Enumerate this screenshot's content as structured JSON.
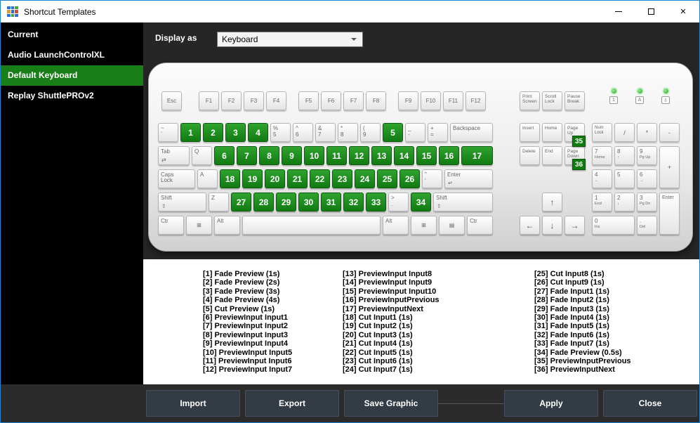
{
  "window": {
    "title": "Shortcut Templates",
    "close_glyph": "×"
  },
  "app_icon_cells": [
    "#2f6fd0",
    "#2f6fd0",
    "#44a544",
    "#e09a3c",
    "#2f6fd0",
    "#cc4b4b",
    "#2f6fd0",
    "#44a544",
    "#2f6fd0"
  ],
  "colors": {
    "accent_green": "#187e18",
    "key_green": "#117a11",
    "key_green_light": "#2fa32f"
  },
  "sidebar": {
    "items": [
      {
        "label": "Current",
        "selected": false
      },
      {
        "label": "Audio LaunchControlXL",
        "selected": false
      },
      {
        "label": "Default Keyboard",
        "selected": true
      },
      {
        "label": "Replay ShuttlePROv2",
        "selected": false
      }
    ]
  },
  "toolbar": {
    "label": "Display as",
    "value": "Keyboard"
  },
  "keyboard": {
    "esc": "Esc",
    "func_groups": [
      [
        "F1",
        "F2",
        "F3",
        "F4"
      ],
      [
        "F5",
        "F6",
        "F7",
        "F8"
      ],
      [
        "F9",
        "F10",
        "F11",
        "F12"
      ]
    ],
    "sys_keys": [
      {
        "l": "Print\nScreen",
        "n": "print-screen"
      },
      {
        "l": "Scroll\nLock",
        "n": "scroll-lock"
      },
      {
        "l": "Pause\nBreak",
        "n": "pause-break"
      }
    ],
    "leds": [
      {
        "symbol": "1",
        "name": "num-lock-led"
      },
      {
        "symbol": "A",
        "name": "caps-lock-led"
      },
      {
        "symbol": "⇩",
        "name": "scroll-lock-led"
      }
    ],
    "main_rows": [
      [
        {
          "t": "~",
          "b": "`",
          "n": "backtick"
        },
        {
          "g": 1
        },
        {
          "g": 2
        },
        {
          "g": 3
        },
        {
          "g": 4
        },
        {
          "t": "%",
          "b": "5",
          "n": "5"
        },
        {
          "t": "^",
          "b": "6",
          "n": "6"
        },
        {
          "t": "&",
          "b": "7",
          "n": "7"
        },
        {
          "t": "*",
          "b": "8",
          "n": "8"
        },
        {
          "t": "(",
          "b": "9",
          "n": "9"
        },
        {
          "g": 5
        },
        {
          "t": "_",
          "b": "-",
          "n": "minus"
        },
        {
          "t": "+",
          "b": "=",
          "n": "equals"
        },
        {
          "l": "Backspace",
          "w": 2,
          "n": "backspace"
        }
      ],
      [
        {
          "l": "Tab",
          "sub": "⇄",
          "w": 1.5,
          "n": "tab"
        },
        {
          "l": "Q",
          "n": "q"
        },
        {
          "g": 6
        },
        {
          "g": 7
        },
        {
          "g": 8
        },
        {
          "g": 9
        },
        {
          "g": 10
        },
        {
          "g": 11
        },
        {
          "g": 12
        },
        {
          "g": 13
        },
        {
          "g": 14
        },
        {
          "g": 15
        },
        {
          "g": 16
        },
        {
          "g": 17,
          "w": 1.5
        }
      ],
      [
        {
          "l": "Caps\nLock",
          "w": 1.75,
          "n": "caps-lock"
        },
        {
          "l": "A",
          "n": "a"
        },
        {
          "g": 18
        },
        {
          "g": 19
        },
        {
          "g": 20
        },
        {
          "g": 21
        },
        {
          "g": 22
        },
        {
          "g": 23
        },
        {
          "g": 24
        },
        {
          "g": 25
        },
        {
          "g": 26
        },
        {
          "t": "\"",
          "b": "'",
          "n": "quote"
        },
        {
          "l": "Enter",
          "sub": "↵",
          "w": 2.25,
          "n": "enter"
        }
      ],
      [
        {
          "l": "Shift",
          "sub": "⇧",
          "w": 2.25,
          "n": "shift-left"
        },
        {
          "l": "Z",
          "n": "z"
        },
        {
          "g": 27
        },
        {
          "g": 28
        },
        {
          "g": 29
        },
        {
          "g": 30
        },
        {
          "g": 31
        },
        {
          "g": 32
        },
        {
          "g": 33
        },
        {
          "t": ">",
          "b": ".",
          "n": "period"
        },
        {
          "g": 34
        },
        {
          "l": "Shift",
          "sub": "⇧",
          "w": 2.75,
          "n": "shift-right"
        }
      ],
      [
        {
          "l": "Ctr",
          "w": 1.25,
          "n": "ctrl-left"
        },
        {
          "l": "⊞",
          "w": 1.25,
          "cls": "ctr",
          "n": "win-left"
        },
        {
          "l": "Alt",
          "w": 1.25,
          "n": "alt-left"
        },
        {
          "l": "",
          "w": 6.25,
          "n": "space"
        },
        {
          "l": "Alt",
          "w": 1.25,
          "n": "alt-right"
        },
        {
          "l": "⊞",
          "w": 1.25,
          "cls": "ctr",
          "n": "win-right"
        },
        {
          "l": "▤",
          "w": 1.25,
          "cls": "ctr",
          "n": "menu"
        },
        {
          "l": "Ctr",
          "w": 1.25,
          "n": "ctrl-right"
        }
      ]
    ],
    "nav_rows": [
      [
        {
          "l": "Insert",
          "n": "insert"
        },
        {
          "l": "Home",
          "n": "home"
        },
        {
          "l": "Page\nUp",
          "badge": 35,
          "n": "page-up"
        }
      ],
      [
        {
          "l": "Delete",
          "n": "delete"
        },
        {
          "l": "End",
          "n": "end"
        },
        {
          "l": "Page\nDown",
          "badge": 36,
          "n": "page-down"
        }
      ]
    ],
    "arrows": [
      {
        "l": "↑",
        "cls": "ctr",
        "n": "arrow-up"
      },
      {
        "l": "←",
        "cls": "ctr",
        "n": "arrow-left"
      },
      {
        "l": "↓",
        "cls": "ctr",
        "n": "arrow-down"
      },
      {
        "l": "→",
        "cls": "ctr",
        "n": "arrow-right"
      }
    ],
    "numpad": [
      {
        "l": "Num\nLock",
        "cls": "tiny",
        "r": 1,
        "c": 1,
        "n": "num-lock"
      },
      {
        "l": "/",
        "cls": "ctr",
        "r": 1,
        "c": 2,
        "n": "numpad-divide"
      },
      {
        "l": "*",
        "cls": "ctr",
        "r": 1,
        "c": 3,
        "n": "numpad-multiply"
      },
      {
        "l": "-",
        "cls": "ctr",
        "r": 1,
        "c": 4,
        "n": "numpad-minus"
      },
      {
        "t": "7",
        "b": "Home",
        "r": 2,
        "c": 1,
        "n": "numpad-7"
      },
      {
        "t": "8",
        "b": "↑",
        "r": 2,
        "c": 2,
        "n": "numpad-8"
      },
      {
        "t": "9",
        "b": "Pg Up",
        "r": 2,
        "c": 3,
        "n": "numpad-9"
      },
      {
        "l": "+",
        "cls": "ctr",
        "r": 2,
        "c": 4,
        "rs": 2,
        "n": "numpad-plus"
      },
      {
        "t": "4",
        "b": "←",
        "r": 3,
        "c": 1,
        "n": "numpad-4"
      },
      {
        "t": "5",
        "b": "",
        "r": 3,
        "c": 2,
        "n": "numpad-5"
      },
      {
        "t": "6",
        "b": "→",
        "r": 3,
        "c": 3,
        "n": "numpad-6"
      },
      {
        "t": "1",
        "b": "End",
        "r": 4,
        "c": 1,
        "n": "numpad-1"
      },
      {
        "t": "2",
        "b": "↓",
        "r": 4,
        "c": 2,
        "n": "numpad-2"
      },
      {
        "t": "3",
        "b": "Pg Dn",
        "r": 4,
        "c": 3,
        "n": "numpad-3"
      },
      {
        "l": "Enter",
        "r": 4,
        "c": 4,
        "rs": 2,
        "n": "numpad-enter"
      },
      {
        "t": "0",
        "b": "Ins",
        "r": 5,
        "c": 1,
        "cs": 2,
        "n": "numpad-0"
      },
      {
        "t": ".",
        "b": "Del",
        "r": 5,
        "c": 3,
        "n": "numpad-period"
      }
    ]
  },
  "shortcuts": {
    "columns": [
      [
        "[1] Fade Preview (1s)",
        "[2] Fade Preview (2s)",
        "[3] Fade Preview (3s)",
        "[4] Fade Preview (4s)",
        "[5] Cut Preview (1s)",
        "[6] PreviewInput Input1",
        "[7] PreviewInput Input2",
        "[8] PreviewInput Input3",
        "[9] PreviewInput Input4",
        "[10] PreviewInput Input5",
        "[11] PreviewInput Input6",
        "[12] PreviewInput Input7"
      ],
      [
        "[13] PreviewInput Input8",
        "[14] PreviewInput Input9",
        "[15] PreviewInput Input10",
        "[16] PreviewInputPrevious",
        "[17] PreviewInputNext",
        "[18] Cut Input1 (1s)",
        "[19] Cut Input2 (1s)",
        "[20] Cut Input3 (1s)",
        "[21] Cut Input4 (1s)",
        "[22] Cut Input5 (1s)",
        "[23] Cut Input6 (1s)",
        "[24] Cut Input7 (1s)"
      ],
      [
        "[25] Cut Input8 (1s)",
        "[26] Cut Input9 (1s)",
        "[27] Fade Input1 (1s)",
        "[28] Fade Input2 (1s)",
        "[29] Fade Input3 (1s)",
        "[30] Fade Input4 (1s)",
        "[31] Fade Input5 (1s)",
        "[32] Fade Input6 (1s)",
        "[33] Fade Input7 (1s)",
        "[34] Fade Preview (0.5s)",
        "[35] PreviewInputPrevious",
        "[36] PreviewInputNext"
      ]
    ]
  },
  "footer": {
    "buttons": [
      "Import",
      "Export",
      "Save Graphic",
      "Apply",
      "Close"
    ]
  }
}
